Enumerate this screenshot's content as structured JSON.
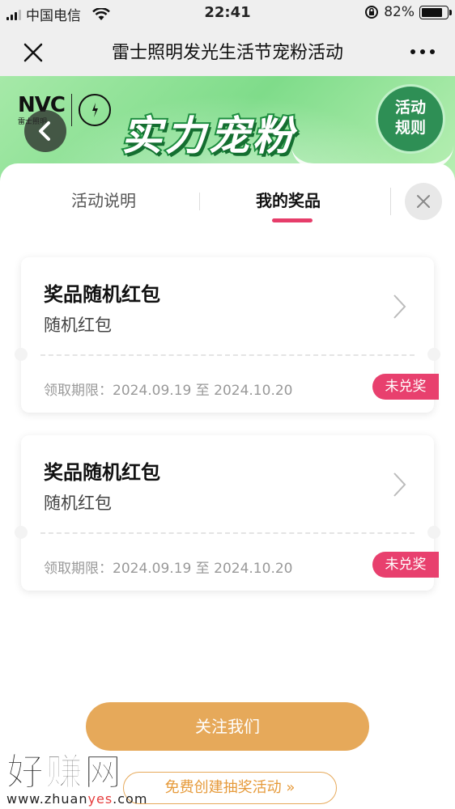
{
  "status_bar": {
    "carrier": "中国电信",
    "time": "22:41",
    "battery": "82%",
    "battery_level": 0.82,
    "icons": [
      "signal-icon",
      "wifi-icon",
      "orientation-lock-icon",
      "battery-icon"
    ]
  },
  "nav": {
    "title": "雷士照明发光生活节宠粉活动",
    "icons": [
      "close-icon",
      "more-icon"
    ]
  },
  "banner": {
    "brand": "NVC",
    "brand_sub": "雷士照明",
    "slogan": "实力宠粉",
    "rules_button": [
      "活动",
      "规则"
    ],
    "colors": {
      "background": "#8fe296",
      "rules_button": "#2e8f55"
    },
    "icons": [
      "back-icon"
    ]
  },
  "tabs": [
    {
      "label": "活动说明",
      "active": false
    },
    {
      "label": "我的奖品",
      "active": true
    }
  ],
  "prizes": [
    {
      "title": "奖品随机红包",
      "subtitle": "随机红包",
      "validity": "领取期限：2024.09.19 至 2024.10.20",
      "status": "未兑奖"
    },
    {
      "title": "奖品随机红包",
      "subtitle": "随机红包",
      "validity": "领取期限：2024.09.19 至 2024.10.20",
      "status": "未兑奖"
    }
  ],
  "buttons": {
    "follow": "关注我们",
    "create": "免费创建抽奖活动 »"
  },
  "watermark": {
    "text": "好赚网",
    "url_prefix": "www.zhuan",
    "url_highlight": "yes",
    "url_suffix": ".com"
  },
  "colors": {
    "accent": "#e63d6a",
    "badge": "#e8406e",
    "follow_button": "#e6a95a"
  }
}
